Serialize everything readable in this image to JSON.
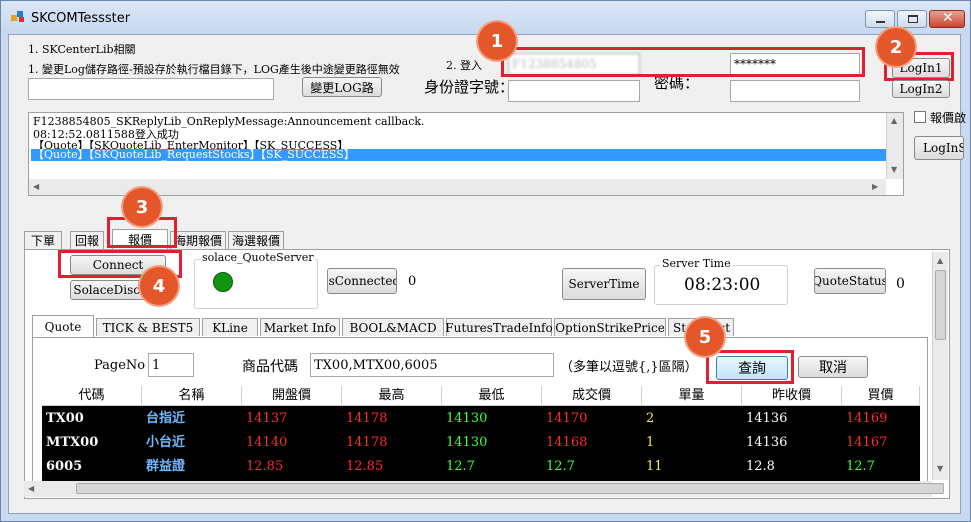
{
  "app": {
    "title": "SKCOMTessster"
  },
  "login": {
    "section_label": "1. SKCenterLib相關",
    "log_path_label": "1. 變更Log儲存路徑-預設存於執行檔目錄下，LOG產生後中途變更路徑無效",
    "log_path_value": "",
    "change_log_button": "變更LOG路",
    "login_step_label": "2. 登入",
    "id_label": "身份證字號：",
    "password_label": "密碼：",
    "id_value": "F1238854805",
    "password_value": "*******",
    "id2_value": "",
    "password2_value": "",
    "login1_button": "LogIn1",
    "login2_button": "LogIn2",
    "report_checkbox_label": "報價啟",
    "loginse_button": "LogInSe"
  },
  "log": {
    "lines": [
      "F1238854805_SKReplyLib_OnReplyMessage:Announcement callback.",
      "08:12:52.0811588登入成功",
      "【Quote】【SKQuoteLib_EnterMonitor】【SK_SUCCESS】",
      "【Quote】【SKQuoteLib_RequestStocks】【SK_SUCCESS】"
    ]
  },
  "main_tabs": [
    "下單",
    "回報",
    "報價",
    "海期報價",
    "海選報價"
  ],
  "quote_panel": {
    "connect_button": "Connect",
    "solace_disconnect_button": "SolaceDisconn",
    "solace_group_label": "solace_QuoteServer",
    "is_connected_button": "IsConnected",
    "is_connected_value": "0",
    "server_time_button": "ServerTime",
    "server_time_group_label": "Server Time",
    "server_time_value": "08:23:00",
    "quote_status_button": "QuoteStatus",
    "quote_status_value": "0",
    "status_color": "#129412"
  },
  "sub_tabs": [
    "Quote",
    "TICK & BEST5",
    "KLine",
    "Market Info",
    "BOOL&MACD",
    "FuturesTradeInfo",
    "OptionStrikePrice",
    "StockList"
  ],
  "query": {
    "page_no_label": "PageNo",
    "page_no_value": "1",
    "product_code_label": "商品代碼",
    "product_code_value": "TX00,MTX00,6005",
    "hint": "（多筆以逗號{,}區隔）",
    "query_button": "查詢",
    "cancel_button": "取消"
  },
  "table": {
    "columns": [
      "代碼",
      "名稱",
      "開盤價",
      "最高",
      "最低",
      "成交價",
      "單量",
      "昨收價",
      "買價"
    ],
    "rows": [
      [
        "TX00",
        "台指近",
        "14137",
        "14178",
        "14130",
        "14170",
        "2",
        "14136",
        "14169"
      ],
      [
        "MTX00",
        "小台近",
        "14140",
        "14178",
        "14130",
        "14168",
        "1",
        "14136",
        "14167"
      ],
      [
        "6005",
        "群益證",
        "12.85",
        "12.85",
        "12.7",
        "12.7",
        "11",
        "12.8",
        "12.7"
      ]
    ],
    "cell_colors": [
      [
        "#ffffff",
        "#6fb8ff",
        "#ff2a2a",
        "#ff2a2a",
        "#3cff3c",
        "#ff2a2a",
        "#ffe84a",
        "#ffffff",
        "#ff2a2a"
      ],
      [
        "#ffffff",
        "#6fb8ff",
        "#ff2a2a",
        "#ff2a2a",
        "#3cff3c",
        "#ff2a2a",
        "#ffe84a",
        "#ffffff",
        "#ff2a2a"
      ],
      [
        "#ffffff",
        "#6fb8ff",
        "#ff2a2a",
        "#ff2a2a",
        "#3cff3c",
        "#3cff3c",
        "#ffe84a",
        "#ffffff",
        "#3cff3c"
      ]
    ]
  },
  "badges": [
    "1",
    "2",
    "3",
    "4",
    "5"
  ],
  "colors": {
    "highlight": "#e02030",
    "badge": "#e4572a",
    "selection": "#3399ff"
  }
}
